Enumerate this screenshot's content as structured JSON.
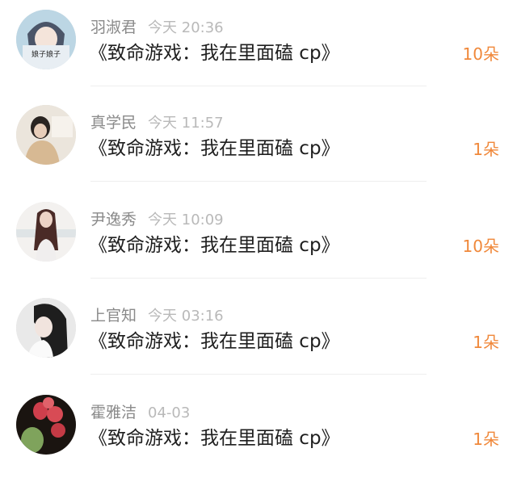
{
  "gifts": {
    "items": [
      {
        "name": "羽淑君",
        "time": "今天 20:36",
        "title": "《致命游戏：我在里面磕 cp》",
        "count": "10朵",
        "avatar_icon": "anime-girl-avatar",
        "avatar_caption": "娘子娘子"
      },
      {
        "name": "真学民",
        "time": "今天 11:57",
        "title": "《致命游戏：我在里面磕 cp》",
        "count": "1朵",
        "avatar_icon": "girl-room-avatar"
      },
      {
        "name": "尹逸秀",
        "time": "今天 10:09",
        "title": "《致命游戏：我在里面磕 cp》",
        "count": "10朵",
        "avatar_icon": "long-hair-girl-avatar"
      },
      {
        "name": "上官知",
        "time": "今天 03:16",
        "title": "《致命游戏：我在里面磕 cp》",
        "count": "1朵",
        "avatar_icon": "dark-hair-girl-avatar"
      },
      {
        "name": "霍雅洁",
        "time": "04-03",
        "title": "《致命游戏：我在里面磕 cp》",
        "count": "1朵",
        "avatar_icon": "cactus-flower-avatar"
      }
    ]
  },
  "colors": {
    "count": "#f0883a",
    "name": "#8a8a8a",
    "time": "#b9b9b9",
    "title": "#1f1f1f"
  }
}
